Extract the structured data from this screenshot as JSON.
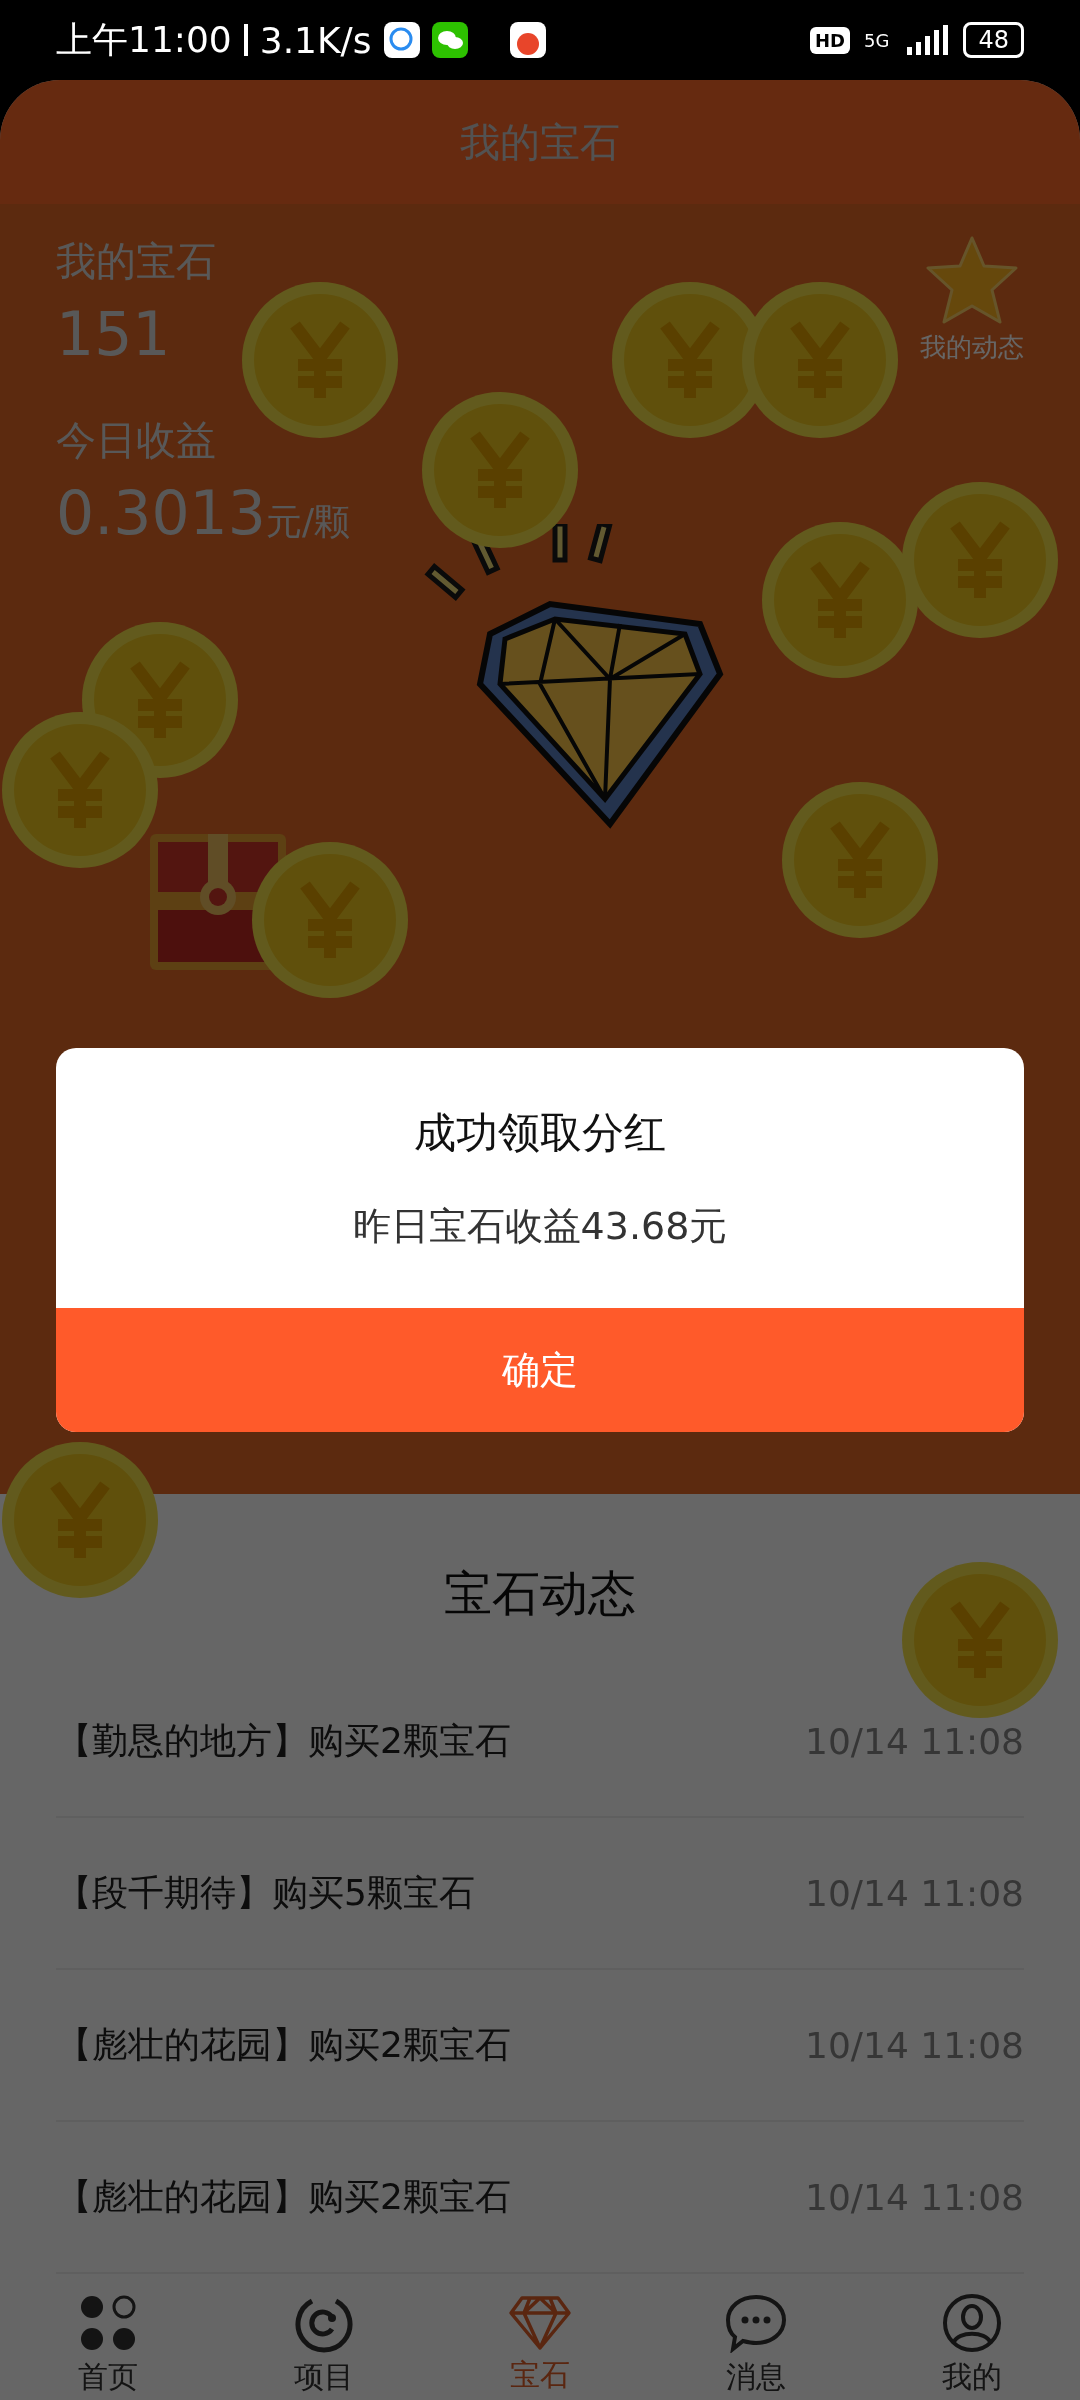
{
  "status_bar": {
    "time": "上午11:00",
    "speed": "3.1K/s",
    "network": "5G",
    "hd": "HD",
    "battery": "48"
  },
  "header": {
    "title": "我的宝石"
  },
  "stats": [
    {
      "label": "我的宝石",
      "value": "151"
    },
    {
      "label": "今日收益",
      "value": "0.3013",
      "unit": "元/颗"
    }
  ],
  "activity_link": {
    "label": "我的动态"
  },
  "dialog": {
    "title": "成功领取分红",
    "message": "昨日宝石收益43.68元",
    "button": "确定"
  },
  "feed": {
    "title": "宝石动态",
    "rows": [
      {
        "text": "【勤恳的地方】购买2颗宝石",
        "time": "10/14 11:08"
      },
      {
        "text": "【段千期待】购买5颗宝石",
        "time": "10/14 11:08"
      },
      {
        "text": "【彪壮的花园】购买2颗宝石",
        "time": "10/14 11:08"
      },
      {
        "text": "【彪壮的花园】购买2颗宝石",
        "time": "10/14 11:08"
      }
    ]
  },
  "tabs": [
    {
      "label": "首页",
      "kind": "dots",
      "selected": false
    },
    {
      "label": "项目",
      "kind": "ring",
      "selected": false
    },
    {
      "label": "宝石",
      "kind": "gem",
      "selected": true
    },
    {
      "label": "消息",
      "kind": "chat",
      "selected": false
    },
    {
      "label": "我的",
      "kind": "user",
      "selected": false
    }
  ]
}
